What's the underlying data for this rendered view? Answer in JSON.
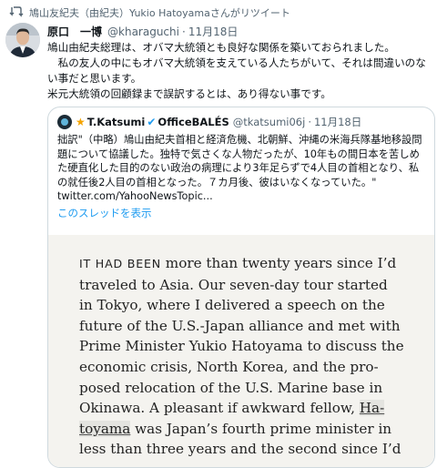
{
  "retweet_header": {
    "text": "鳩山友紀夫（由紀夫）Yukio Hatoyamaさんがリツイート",
    "icon": "retweet-icon"
  },
  "tweet": {
    "author_name": "原口　一博",
    "author_handle": "@kharaguchi",
    "separator": "·",
    "date": "11月18日",
    "lines": [
      "鳩山由紀夫総理は、オバマ大統領とも良好な関係を築いておられました。",
      "　私の友人の中にもオバマ大統領を支えている人たちがいて、それは間違いのない事だと思います。",
      "米元大統領の回顧録まで誤訳するとは、あり得ない事です。"
    ]
  },
  "quoted_tweet": {
    "author_name": "T.Katsumi",
    "author_suffix": "OfficeBALÉS",
    "author_handle": "@tkatsumi06j",
    "separator": "·",
    "date": "11月18日",
    "text": "拙訳\"（中略）鳩山由紀夫首相と経済危機、北朝鮮、沖縄の米海兵隊基地移設問題について協議した。独特で気さくな人物だったが、10年もの間日本を苦しめた硬直化した目的のない政治の病理により3年足らずで4人目の首相となり、私の就任後2人目の首相となった。７カ月後、彼はいなくなっていた。\" twitter.com/YahooNewsTopic...",
    "thread_link": "このスレッドを表示"
  },
  "book_excerpt": {
    "lead_caps": "IT HAD BEEN",
    "line1_rest": " more than twenty years since I’d",
    "line2": "traveled to Asia. Our seven-day tour started",
    "line3": "in Tokyo, where I delivered a speech on the",
    "line4": "future of the U.S.-Japan alliance and met with",
    "line5": "Prime Minister Yukio Hatoyama to discuss the",
    "line6": "economic crisis, North Korea, and the pro-",
    "line7": "posed relocation of the U.S. Marine base in",
    "line8_pre": "Okinawa. A pleasant if awkward fellow, ",
    "line8_hl": "Ha-",
    "line9_hl": "toyama",
    "line9_post": " was Japan’s fourth prime minister in",
    "line10": "less than three years and the second since I’d"
  },
  "actions": {
    "reply_count": "",
    "retweet_count": "",
    "like_count": ""
  },
  "colors": {
    "link": "#1d9bf0",
    "muted": "#536471",
    "border": "#cfd9de",
    "book_background": "#f4f3ef"
  }
}
